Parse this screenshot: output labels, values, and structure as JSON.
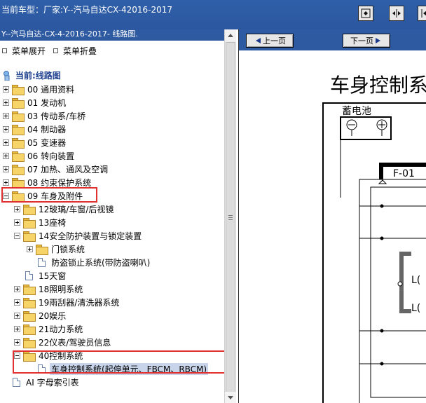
{
  "header": {
    "title": "当前车型：厂家:Y--汽马自达CX-42016-2017",
    "buttons": [
      {
        "name": "fit-page-button",
        "icon": "fit-page-icon"
      },
      {
        "name": "fit-width-button",
        "icon": "fit-width-icon"
      },
      {
        "name": "expand-button",
        "icon": "expand-icon"
      }
    ]
  },
  "left_panel": {
    "title": "Y--汽马自达-CX-4-2016-2017- 线路图.",
    "menu": {
      "expand_label": "菜单展开",
      "collapse_label": "菜单折叠"
    },
    "tree": {
      "current_label": "当前:线路图",
      "items": [
        {
          "label": "00 通用资料",
          "type": "folder",
          "expander": "plus"
        },
        {
          "label": "01 发动机",
          "type": "folder",
          "expander": "plus"
        },
        {
          "label": "03 传动系/车桥",
          "type": "folder",
          "expander": "plus"
        },
        {
          "label": "04 制动器",
          "type": "folder",
          "expander": "plus"
        },
        {
          "label": "05 变速器",
          "type": "folder",
          "expander": "plus"
        },
        {
          "label": "06 转向装置",
          "type": "folder",
          "expander": "plus"
        },
        {
          "label": "07 加热、通风及空调",
          "type": "folder",
          "expander": "plus"
        },
        {
          "label": "08 约束保护系统",
          "type": "folder",
          "expander": "plus"
        },
        {
          "label": "09 车身及附件",
          "type": "folder",
          "expander": "minus",
          "highlighted": true
        },
        {
          "label": "12玻璃/车窗/后视镜",
          "type": "folder",
          "expander": "plus"
        },
        {
          "label": "13座椅",
          "type": "folder",
          "expander": "plus"
        },
        {
          "label": "14安全防护装置与锁定装置",
          "type": "folder",
          "expander": "minus"
        },
        {
          "label": "门锁系统",
          "type": "folder",
          "expander": "plus"
        },
        {
          "label": "防盗锁止系统(带防盗喇叭)",
          "type": "doc"
        },
        {
          "label": "15天窗",
          "type": "doc"
        },
        {
          "label": "18照明系统",
          "type": "folder",
          "expander": "plus"
        },
        {
          "label": "19雨刮器/清洗器系统",
          "type": "folder",
          "expander": "plus"
        },
        {
          "label": "20娱乐",
          "type": "folder",
          "expander": "plus"
        },
        {
          "label": "21动力系统",
          "type": "folder",
          "expander": "plus"
        },
        {
          "label": "22仪表/驾驶员信息",
          "type": "folder",
          "expander": "plus"
        },
        {
          "label": "40控制系统",
          "type": "folder",
          "expander": "minus",
          "highlighted": true
        },
        {
          "label": "车身控制系统(起停单元、FBCM、RBCM)",
          "type": "doc",
          "selected": true,
          "highlighted": true
        },
        {
          "label": "AI 字母索引表",
          "type": "doc"
        }
      ]
    }
  },
  "right_panel": {
    "prev_page_label": "上一页",
    "next_page_label": "下一页",
    "document": {
      "title": "车身控制系",
      "battery_label": "蓄电池",
      "connector_label": "F-01",
      "pin_label_1": "L(",
      "pin_label_2": "L("
    }
  },
  "colors": {
    "header_bg": "#2f5fa8",
    "highlight_border": "#e0302f",
    "selected_bg": "#c8d4ea",
    "folder_fill": "#f6d467"
  }
}
